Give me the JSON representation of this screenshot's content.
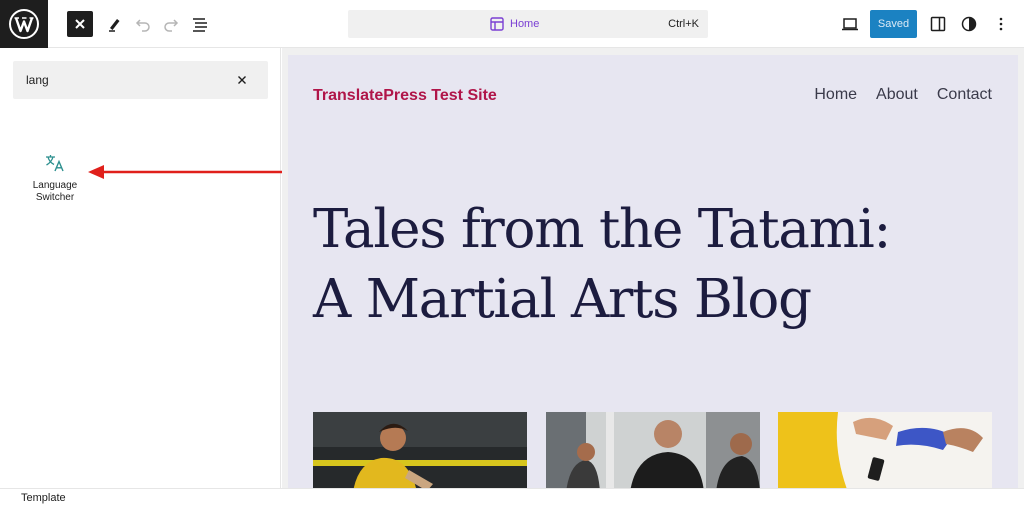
{
  "toolbar": {
    "logo_icon": "wordpress-logo-icon",
    "close_icon": "close-icon",
    "tool_icon": "pen-tool-icon",
    "undo_icon": "undo-icon",
    "redo_icon": "redo-icon",
    "outline_icon": "document-overview-icon",
    "command_bar": {
      "title": "Home",
      "icon": "template-icon",
      "shortcut": "Ctrl+K"
    },
    "view_icon": "desktop-view-icon",
    "saved_label": "Saved",
    "settings_icon": "sidebar-settings-icon",
    "styles_icon": "styles-half-circle-icon",
    "options_icon": "more-vertical-icon",
    "accent_color": "#1b82c2"
  },
  "sidebar": {
    "search": {
      "value": "lang",
      "clear_icon": "close-icon"
    },
    "results": [
      {
        "label": "Language Switcher",
        "icon": "translate-icon"
      }
    ]
  },
  "annotation": {
    "arrow_color": "#e0201b"
  },
  "canvas": {
    "site_title": "TranslatePress Test Site",
    "site_title_color": "#b01549",
    "nav": [
      "Home",
      "About",
      "Contact"
    ],
    "headline_line1": "Tales from the Tatami:",
    "headline_line2": "A Martial Arts Blog",
    "background": "#e7e6f1",
    "images": [
      "martial-arts-photo",
      "martial-arts-photo",
      "martial-arts-photo"
    ]
  },
  "footer": {
    "breadcrumb": "Template"
  }
}
